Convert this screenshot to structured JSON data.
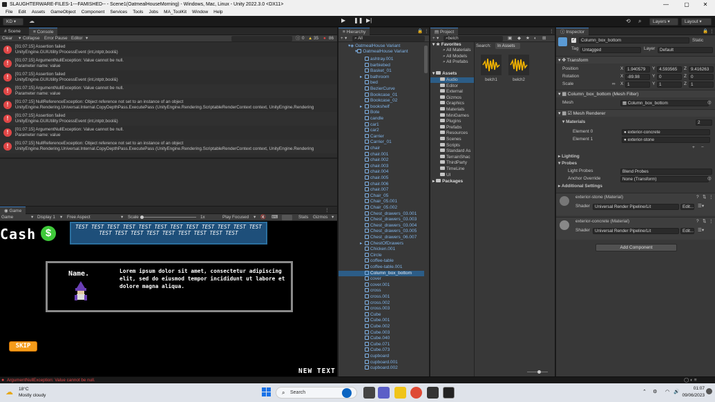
{
  "window": {
    "title": "SLAUGHTERWARE-FILES-1---FAMISHED-- - Scene1(OatmealHouseMorning) - Windows, Mac, Linux - Unity 2022.3.0 <DX11>"
  },
  "menu": [
    "File",
    "Edit",
    "Assets",
    "GameObject",
    "Component",
    "Services",
    "Tools",
    "Jobs",
    "MA_ToolKit",
    "Window",
    "Help"
  ],
  "toolbar": {
    "account": "KD",
    "layers": "Layers",
    "layout": "Layout"
  },
  "scene_tab": "Scene",
  "console_tab": "Console",
  "console": {
    "clear": "Clear",
    "collapse": "Collapse",
    "error_pause": "Error Pause",
    "editor": "Editor",
    "counts": {
      "logs": "0",
      "warnings": "35",
      "errors": "86"
    },
    "entries": [
      {
        "l1": "[01:07:15] Assertion failed",
        "l2": "UnityEngine.GUIUtility:ProcessEvent (int,intptr,bool&)"
      },
      {
        "l1": "[01:07:15] ArgumentNullException: Value cannot be null.",
        "l2": "Parameter name: value"
      },
      {
        "l1": "[01:07:15] Assertion failed",
        "l2": "UnityEngine.GUIUtility:ProcessEvent (int,intptr,bool&)"
      },
      {
        "l1": "[01:07:15] ArgumentNullException: Value cannot be null.",
        "l2": "Parameter name: value"
      },
      {
        "l1": "[01:07:15] NullReferenceException: Object reference not set to an instance of an object",
        "l2": "UnityEngine.Rendering.Universal.Internal.CopyDepthPass.ExecutePass (UnityEngine.Rendering.ScriptableRenderContext context, UnityEngine.Rendering"
      },
      {
        "l1": "[01:07:15] Assertion failed",
        "l2": "UnityEngine.GUIUtility:ProcessEvent (int,intptr,bool&)"
      },
      {
        "l1": "[01:07:15] ArgumentNullException: Value cannot be null.",
        "l2": "Parameter name: value"
      },
      {
        "l1": "[01:07:15] NullReferenceException: Object reference not set to an instance of an object",
        "l2": "UnityEngine.Rendering.Universal.Internal.CopyDepthPass.ExecutePass (UnityEngine.Rendering.ScriptableRenderContext context, UnityEngine.Rendering"
      }
    ]
  },
  "game": {
    "tab": "Game",
    "mode": "Game",
    "display": "Display 1",
    "aspect": "Free Aspect",
    "scale_label": "Scale",
    "scale_value": "1x",
    "play_focused": "Play Focused",
    "stats": "Stats",
    "gizmos": "Gizmos",
    "cash": "Cash",
    "banner": "TEST TEST TEST TEST TEST TEST TEST TEST TEST TEST TEST TEST TEST TEST TEST TEST TEST TEST TEST TEST TEST",
    "dialog_name": "Name.",
    "dialog_text": "Lorem ipsum dolor sit amet, consectetur adipiscing elit, sed do eiusmod tempor incididunt ut labore et dolore magna aliqua.",
    "skip": "SKIP",
    "new_text": "NEW TEXT"
  },
  "hierarchy": {
    "tab": "Hierarchy",
    "search": "All",
    "root": "OatmealHouse Variant",
    "items": [
      "ashtray.001",
      "barbiebed",
      "Basket_01",
      "bathroom",
      "bed",
      "BezierCurve",
      "Bookcase_01",
      "Bookcase_02",
      "bookshelf",
      "Bote",
      "candle",
      "car1",
      "car2",
      "Carrier",
      "Carrier_01",
      "chair",
      "chair.001",
      "chair.002",
      "chair.003",
      "chair.004",
      "chair.005",
      "chair.006",
      "chair.007",
      "Chair_05",
      "Chair_05.001",
      "Chair_05.002",
      "Chest_drawers_03.001",
      "Chest_drawers_03.003",
      "Chest_drawers_03.004",
      "Chest_drawers_03.005",
      "Chest_drawers_06.007",
      "ChestOfDrawers",
      "Chicken.001",
      "Circle",
      "coffee-table",
      "coffee-table.001",
      "Column_box_bottom",
      "cover",
      "cover.001",
      "cross",
      "cross.001",
      "cross.002",
      "cross.003",
      "Cube",
      "Cube.001",
      "Cube.002",
      "Cube.003",
      "Cube.040",
      "Cube.071",
      "Cube.073",
      "cupboard",
      "cupboard.001",
      "cupboard.002"
    ],
    "selected": "Column_box_bottom"
  },
  "project": {
    "tab": "Project",
    "search": "belch",
    "search_label": "Search:",
    "in_assets": "In Assets",
    "favorites": "Favorites",
    "fav_items": [
      "All Materials",
      "All Models",
      "All Prefabs"
    ],
    "assets": "Assets",
    "asset_folders": [
      "Audio",
      "Editor",
      "External",
      "Gizmos",
      "Graphics",
      "Materials",
      "MiniGames",
      "Plugins",
      "Prefabs",
      "Resources",
      "Scenes",
      "Scripts",
      "Standard As",
      "TerrainShac",
      "ThirdParty",
      "TimeLine",
      "UI"
    ],
    "packages": "Packages",
    "results": [
      "belch1",
      "belch2"
    ]
  },
  "inspector": {
    "tab": "Inspector",
    "name": "Column_box_bottom",
    "static": "Static",
    "tag_label": "Tag",
    "tag": "Untagged",
    "layer_label": "Layer",
    "layer": "Default",
    "transform": "Transform",
    "position_label": "Position",
    "rotation_label": "Rotation",
    "scale_label": "Scale",
    "position": {
      "x": "1.940579",
      "y": "4.593565",
      "z": "9.416263"
    },
    "rotation": {
      "x": "-89.98",
      "y": "0",
      "z": "0"
    },
    "scale": {
      "x": "1",
      "y": "1",
      "z": "1"
    },
    "mesh_filter": "Column_box_bottom (Mesh Filter)",
    "mesh_label": "Mesh",
    "mesh": "Column_box_bottom",
    "mesh_renderer": "Mesh Renderer",
    "materials_label": "Materials",
    "materials_count": "2",
    "element0_label": "Element 0",
    "element0": "exterior-concrete",
    "element1_label": "Element 1",
    "element1": "exterior-stone",
    "lighting": "Lighting",
    "probes": "Probes",
    "light_probes_label": "Light Probes",
    "light_probes": "Blend Probes",
    "anchor_label": "Anchor Override",
    "anchor": "None (Transform)",
    "additional": "Additional Settings",
    "mat1": "exterior-stone (Material)",
    "mat2": "exterior-concrete (Material)",
    "shader_label": "Shader",
    "shader": "Universal Render Pipeline/Lit",
    "edit": "Edit...",
    "add_component": "Add Component"
  },
  "status": {
    "message": "ArgumentNullException: Value cannot be null."
  },
  "taskbar": {
    "temp": "18°C",
    "weather": "Mostly cloudy",
    "search": "Search",
    "time": "01:07",
    "date": "09/06/2023"
  }
}
